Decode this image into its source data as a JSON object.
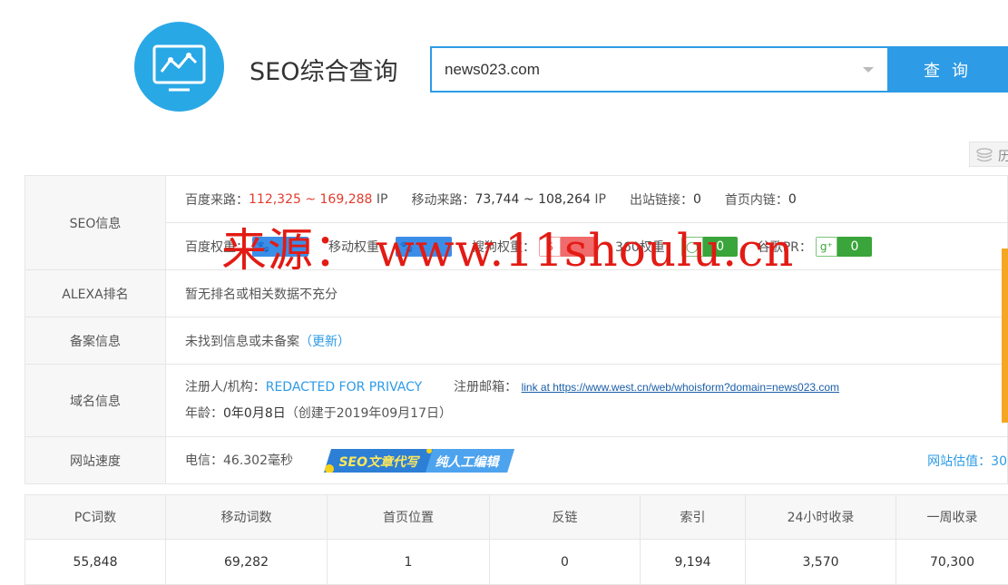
{
  "header": {
    "logo_icon": "monitor-chart-icon",
    "title": "SEO综合查询",
    "search_value": "news023.com",
    "search_button": "查 询",
    "history_label": "历"
  },
  "seo": {
    "label": "SEO信息",
    "baidu_traffic_label": "百度来路：",
    "baidu_traffic_value": "112,325 ~ 169,288",
    "ip_unit": "IP",
    "mobile_traffic_label": "移动来路：",
    "mobile_traffic_value": "73,744 ~ 108,264",
    "outbound_label": "出站链接：",
    "outbound_value": "0",
    "inner_label": "首页内链：",
    "inner_value": "0",
    "baidu_weight_label": "百度权重：",
    "mobile_weight_label": "移动权重：",
    "sogou_weight_label": "搜狗权重：",
    "so360_weight_label": "360权重：",
    "so360_weight_value": "0",
    "google_pr_label": "谷歌PR：",
    "google_pr_value": "0"
  },
  "alexa": {
    "label": "ALEXA排名",
    "value": "暂无排名或相关数据不充分"
  },
  "icp": {
    "label": "备案信息",
    "value": "未找到信息或未备案",
    "update_link": "（更新）"
  },
  "domain": {
    "label": "域名信息",
    "registrant_label": "注册人/机构：",
    "registrant_value": "REDACTED FOR PRIVACY",
    "email_label": "注册邮箱：",
    "email_value": "link at https://www.west.cn/web/whoisform?domain=news023.com",
    "age_label": "年龄：",
    "age_value": "0年0月8日",
    "created_value": "（创建于2019年09月17日）"
  },
  "speed": {
    "label": "网站速度",
    "value": "电信：46.302毫秒",
    "banner_text_1": "SEO文章代写",
    "banner_text_2": "纯人工编辑",
    "valuation": "网站估值：30"
  },
  "stats": {
    "headers": [
      "PC词数",
      "移动词数",
      "首页位置",
      "反链",
      "索引",
      "24小时收录",
      "一周收录"
    ],
    "values": [
      "55,848",
      "69,282",
      "1",
      "0",
      "9,194",
      "3,570",
      "70,300"
    ]
  },
  "watermark": "来源： www.11shoulu.cn",
  "colors": {
    "accent": "#2d9be6",
    "red": "#e23b2e",
    "watermark": "#e21b14"
  }
}
